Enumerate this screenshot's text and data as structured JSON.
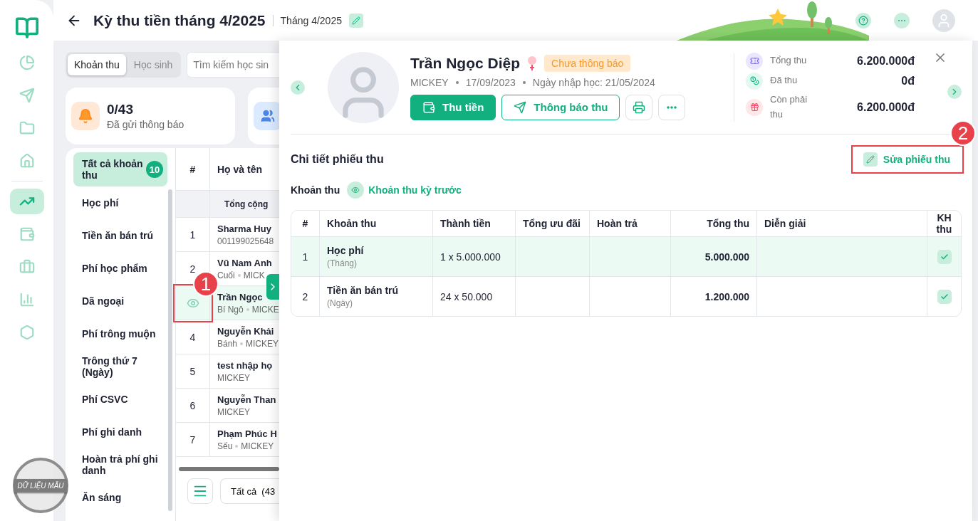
{
  "sidebar": {
    "items": [
      {
        "kind": "pie",
        "selected": false
      },
      {
        "kind": "send",
        "selected": false
      },
      {
        "kind": "folder",
        "selected": false
      },
      {
        "kind": "home",
        "selected": false
      },
      {
        "kind": "chart",
        "selected": true
      },
      {
        "kind": "wallet",
        "selected": false
      },
      {
        "kind": "briefcase",
        "selected": false
      },
      {
        "kind": "bars",
        "selected": false
      },
      {
        "kind": "hexagon",
        "selected": false
      }
    ],
    "sample_badge": "DỮ LIỆU MẪU"
  },
  "header": {
    "title": "Kỳ thu tiền tháng 4/2025",
    "period": "Tháng 4/2025"
  },
  "view_tabs": [
    {
      "label": "Khoản thu",
      "selected": true
    },
    {
      "label": "Học sinh",
      "selected": false
    }
  ],
  "search": {
    "placeholder": "Tìm kiếm học sin"
  },
  "stats": [
    {
      "value": "0/43",
      "label": "Đã gửi thông báo"
    }
  ],
  "categories": [
    {
      "label": "Tất cả khoản thu",
      "count": "10",
      "selected": true
    },
    {
      "label": "Học phí",
      "selected": false
    },
    {
      "label": "Tiền ăn bán trú",
      "selected": false
    },
    {
      "label": "Phí học phẩm",
      "selected": false
    },
    {
      "label": "Dã ngoại",
      "selected": false
    },
    {
      "label": "Phí trông muộn",
      "selected": false
    },
    {
      "label": "Trông thứ 7 (Ngày)",
      "selected": false
    },
    {
      "label": "Phí CSVC",
      "selected": false
    },
    {
      "label": "Phí ghi danh",
      "selected": false
    },
    {
      "label": "Hoàn trả phí ghi danh",
      "selected": false
    },
    {
      "label": "Ăn sáng",
      "selected": false
    }
  ],
  "students_table": {
    "columns": [
      "#",
      "Họ và tên"
    ],
    "total_label": "Tổng cộng",
    "rows": [
      {
        "index": "1",
        "name": "Sharma Huy",
        "tags": [
          "001199025648"
        ],
        "selected": false
      },
      {
        "index": "2",
        "name": "Vũ Nam Anh",
        "tags": [
          "Cuối",
          "MICK"
        ],
        "selected": false
      },
      {
        "name": "Trần Ngọc",
        "tags": [
          "Bí Ngô",
          "MICKE"
        ],
        "selected": true
      },
      {
        "index": "4",
        "name": "Nguyễn Khải",
        "tags": [
          "Bánh",
          "MICKEY"
        ],
        "selected": false
      },
      {
        "index": "5",
        "name": "test nhập họ",
        "tags": [
          "MICKEY"
        ],
        "selected": false
      },
      {
        "index": "6",
        "name": "Nguyễn Than",
        "tags": [
          "MICKEY"
        ],
        "selected": false
      },
      {
        "index": "7",
        "name": "Phạm Phúc H",
        "tags": [
          "Sếu",
          "MICKEY"
        ],
        "selected": false
      }
    ]
  },
  "list_filter": "Tất cả  (43",
  "student": {
    "name": "Trần Ngọc Diệp",
    "status": "Chưa thông báo",
    "class": "MICKEY",
    "birth_date": "17/09/2023",
    "enrolled": "Ngày nhập học: 21/05/2024",
    "actions": [
      "Thu tiền",
      "Thông báo thu"
    ]
  },
  "summary": [
    {
      "kind": "total",
      "label": "Tổng thu",
      "value": "6.200.000đ"
    },
    {
      "kind": "paid",
      "label": "Đã thu",
      "value": "0đ"
    },
    {
      "kind": "due",
      "label": "Còn phải thu",
      "value": "6.200.000đ"
    }
  ],
  "detail": {
    "title": "Chi tiết phiếu thu",
    "edit_label": "Sửa phiếu thu",
    "filter_label": "Khoản thu",
    "previous_link": "Khoản thu kỳ trước"
  },
  "fees_table": {
    "columns": [
      "#",
      "Khoản thu",
      "Thành tiền",
      "Tổng ưu đãi",
      "Hoàn trả",
      "Tổng thu",
      "Diễn giải",
      "KH thu"
    ],
    "rows": [
      {
        "index": "1",
        "name": "Học phí",
        "unit": "(Tháng)",
        "amount": "1 x 5.000.000",
        "total": "5.000.000",
        "planned": true,
        "selected": true
      },
      {
        "index": "2",
        "name": "Tiền ăn bán trú",
        "unit": "(Ngày)",
        "amount": "24 x 50.000",
        "total": "1.200.000",
        "planned": true,
        "selected": false
      }
    ]
  },
  "annotations": [
    {
      "label": "1"
    },
    {
      "label": "2"
    }
  ]
}
